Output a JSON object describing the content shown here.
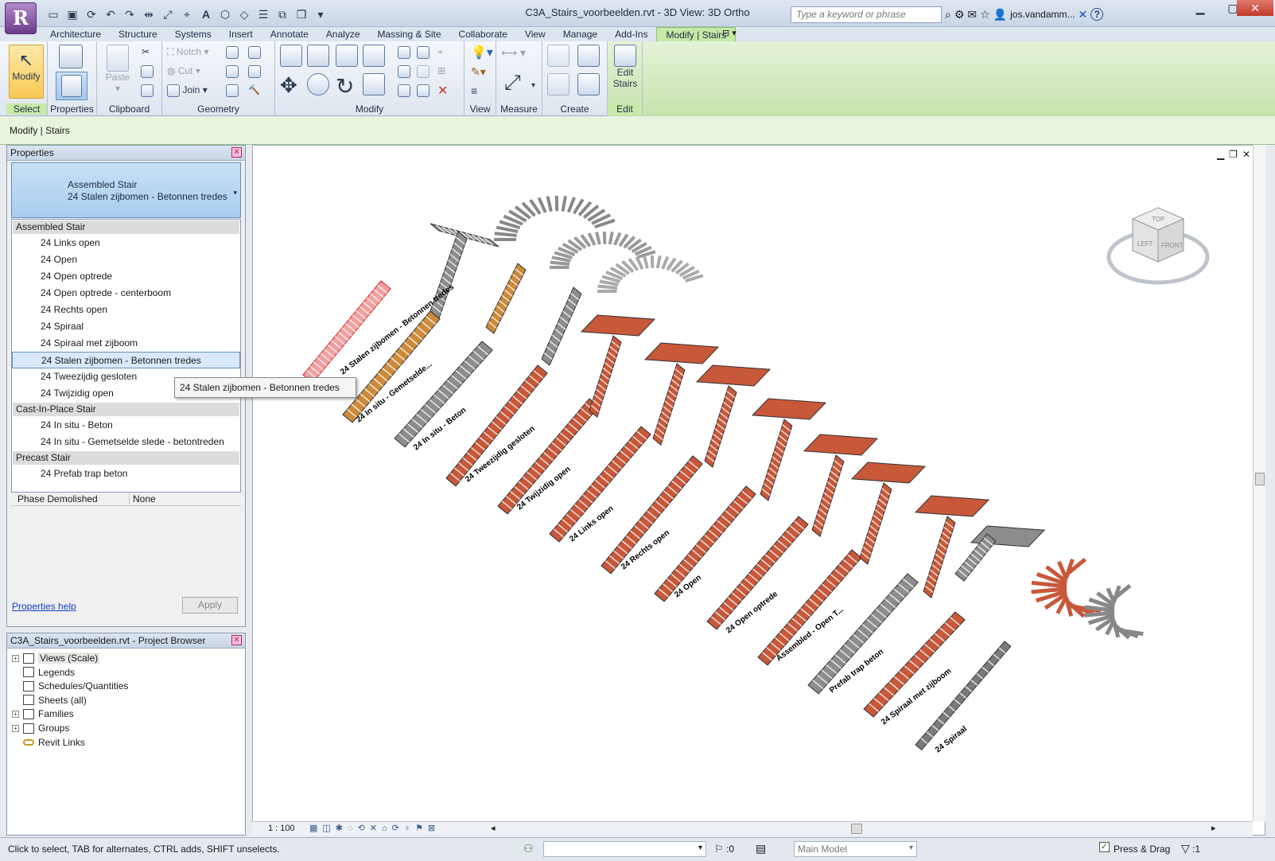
{
  "window": {
    "title": "C3A_Stairs_voorbeelden.rvt - 3D View: 3D Ortho",
    "search_placeholder": "Type a keyword or phrase",
    "user": "jos.vandamm...",
    "help": "?",
    "app_letter": "R"
  },
  "tabs": [
    "Architecture",
    "Structure",
    "Systems",
    "Insert",
    "Annotate",
    "Analyze",
    "Massing & Site",
    "Collaborate",
    "View",
    "Manage",
    "Add-Ins",
    "Modify | Stairs"
  ],
  "ribbon": {
    "panels": {
      "select": "Select",
      "properties": "Properties",
      "clipboard": "Clipboard",
      "geometry": "Geometry",
      "modify": "Modify",
      "view": "View",
      "measure": "Measure",
      "create": "Create",
      "edit": "Edit"
    },
    "modify_button": "Modify",
    "paste_button": "Paste",
    "notch": "Notch",
    "cut": "Cut",
    "join": "Join",
    "edit_stairs_line1": "Edit",
    "edit_stairs_line2": "Stairs"
  },
  "options_bar": "Modify | Stairs",
  "properties": {
    "title": "Properties",
    "family": "Assembled Stair",
    "type": "24 Stalen zijbomen - Betonnen tredes",
    "groups": [
      {
        "name": "Assembled Stair",
        "items": [
          "24 Links open",
          "24 Open",
          "24 Open optrede",
          "24 Open optrede - centerboom",
          "24 Rechts open",
          "24 Spiraal",
          "24 Spiraal met zijboom",
          "24 Stalen zijbomen - Betonnen tredes",
          "24 Tweezijdig gesloten",
          "24 Twijzidig open"
        ]
      },
      {
        "name": "Cast-In-Place Stair",
        "items": [
          "24 In situ - Beton",
          "24 In situ - Gemetselde slede - betontreden"
        ]
      },
      {
        "name": "Precast Stair",
        "items": [
          "24 Prefab trap beton"
        ]
      }
    ],
    "selected_item": "24 Stalen zijbomen - Betonnen tredes",
    "tooltip": "24 Stalen zijbomen - Betonnen tredes",
    "phase_label": "Phase Demolished",
    "phase_value": "None",
    "help_link": "Properties help",
    "apply_button": "Apply"
  },
  "browser": {
    "title": "C3A_Stairs_voorbeelden.rvt - Project Browser",
    "items": [
      "Views (Scale)",
      "Legends",
      "Schedules/Quantities",
      "Sheets (all)",
      "Families",
      "Groups",
      "Revit Links"
    ]
  },
  "viewcube": {
    "top": "TOP",
    "left": "LEFT",
    "front": "FRONT"
  },
  "view_labels": [
    "24 Stalen zijbomen - Betonnen tredes",
    "24 In situ - Gemetselde...",
    "24 In situ - Beton",
    "24 Tweezijdig gesloten",
    "24 Twijzidig open",
    "24 Links open",
    "24 Rechts open",
    "24 Open",
    "24 Open optrede",
    "Assembled - Open T...",
    "Prefab trap beton",
    "24 Spiraal met zijboom",
    "24 Spiraal"
  ],
  "viewbar": {
    "scale": "1 : 100"
  },
  "status": {
    "message": "Click to select, TAB for alternates, CTRL adds, SHIFT unselects.",
    "filter_count": ":0",
    "model": "Main Model",
    "press_drag": "Press & Drag",
    "selection_count": ":1"
  },
  "colors": {
    "accent_green": "#c7e9a8",
    "stair_orange": "#c8583a",
    "stair_gray": "#8d8d8d",
    "selected_red": "#e02020"
  }
}
